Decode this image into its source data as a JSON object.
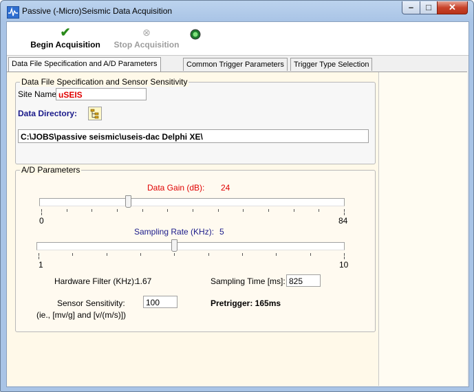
{
  "window": {
    "title": "Passive (-Micro)Seismic Data Acquisition"
  },
  "toolbar": {
    "begin_label": "Begin Acquisition",
    "stop_label": "Stop Acquisition",
    "begin_enabled": true,
    "stop_enabled": false
  },
  "tabs": [
    {
      "label": "Data File Specification and A/D Parameters",
      "active": true
    },
    {
      "label": "Common Trigger Parameters",
      "active": false
    },
    {
      "label": "Trigger Type Selection",
      "active": false
    }
  ],
  "file_group": {
    "legend": "Data File Specification and Sensor Sensitivity",
    "site_name_label": "Site Name:",
    "site_name_value": "uSEIS",
    "data_directory_label": "Data Directory:",
    "data_directory_value": "C:\\JOBS\\passive seismic\\useis-dac Delphi XE\\"
  },
  "ad_group": {
    "legend": "A/D Parameters",
    "gain_label": "Data Gain (dB):",
    "gain_value": "24",
    "gain_min": "0",
    "gain_max": "84",
    "gain_fraction": 0.2857,
    "rate_label": "Sampling Rate (KHz):",
    "rate_value": "5",
    "rate_min": "1",
    "rate_max": "10",
    "rate_fraction": 0.4444,
    "filter_label": "Hardware Filter (KHz):",
    "filter_value": "1.67",
    "sampling_time_label": "Sampling Time [ms]:",
    "sampling_time_value": "825",
    "sensitivity_label": "Sensor Sensitivity:",
    "sensitivity_hint": "(ie., [mv/g] and [v/(m/s)])",
    "sensitivity_value": "100",
    "pretrigger_label": "Pretrigger: 165ms"
  },
  "colors": {
    "accent_red": "#e00000",
    "accent_navy": "#1a1a8a",
    "check_green": "#2a8a1a"
  }
}
